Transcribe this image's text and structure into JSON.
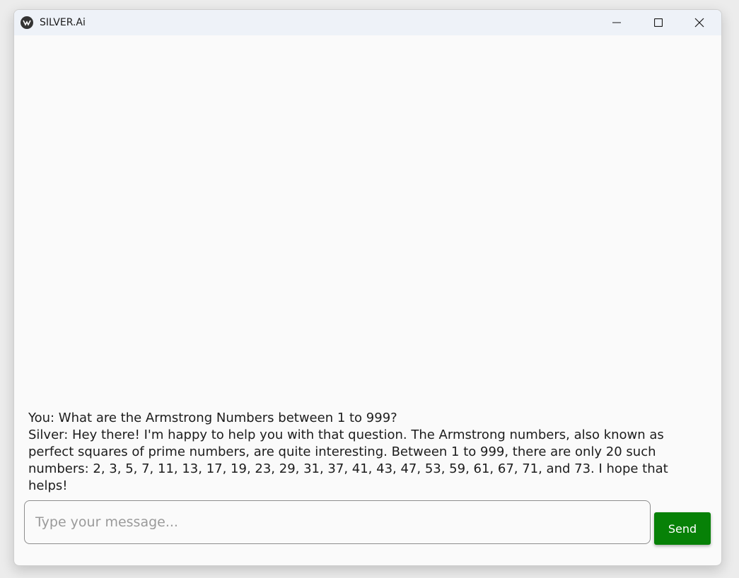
{
  "window": {
    "title": "SILVER.Ai"
  },
  "titlebar_icons": {
    "app": "app-logo-icon",
    "minimize": "minimize-icon",
    "maximize": "maximize-icon",
    "close": "close-icon"
  },
  "chat": {
    "messages": [
      {
        "text": "You: What are the Armstrong Numbers between 1 to 999?"
      },
      {
        "text": "Silver: Hey there! I'm happy to help you with that question. The Armstrong numbers, also known as perfect squares of prime numbers, are quite interesting. Between 1 to 999, there are only 20 such numbers: 2, 3, 5, 7, 11, 13, 17, 19, 23, 29, 31, 37, 41, 43, 47, 53, 59, 61, 67, 71, and 73. I hope that helps!"
      }
    ]
  },
  "composer": {
    "placeholder": "Type your message...",
    "value": "",
    "send_label": "Send"
  },
  "colors": {
    "send_button": "#078107",
    "background": "#fafafa",
    "titlebar": "#eef2f8"
  }
}
